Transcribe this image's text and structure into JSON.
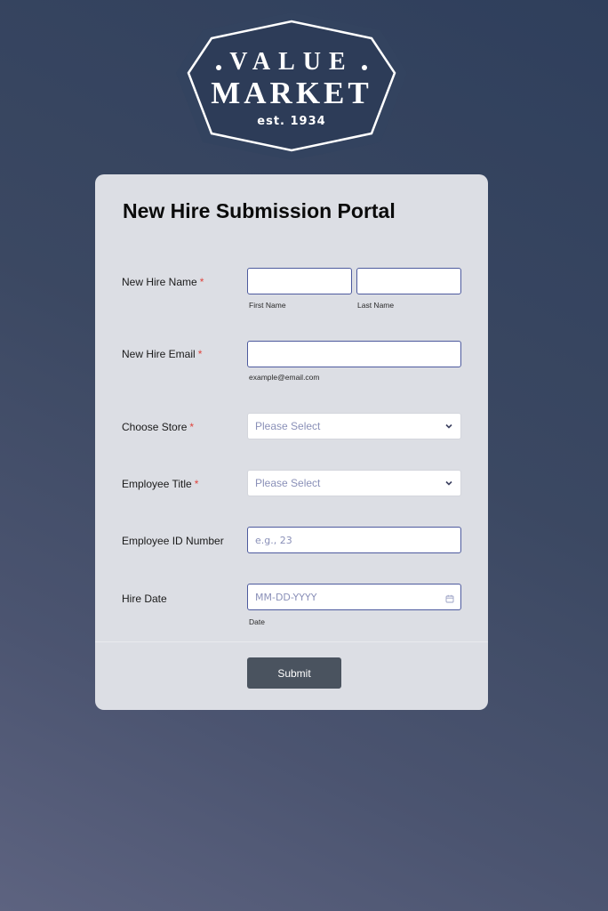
{
  "logo": {
    "line1": "VALUE",
    "line2": "MARKET",
    "line3": "est. 1934"
  },
  "form": {
    "title": "New Hire Submission Portal",
    "required_mark": "*",
    "name": {
      "label": "New Hire Name",
      "first_sub": "First Name",
      "last_sub": "Last Name",
      "first_value": "",
      "last_value": ""
    },
    "email": {
      "label": "New Hire Email",
      "sub": "example@email.com",
      "value": ""
    },
    "store": {
      "label": "Choose Store",
      "selected": "Please Select"
    },
    "title_field": {
      "label": "Employee Title",
      "selected": "Please Select"
    },
    "employee_id": {
      "label": "Employee ID Number",
      "placeholder": "e.g., 23"
    },
    "hire_date": {
      "label": "Hire Date",
      "placeholder": "MM-DD-YYYY",
      "sub": "Date"
    },
    "submit_label": "Submit"
  },
  "icons": {
    "select": "chevron-down-icon",
    "date": "calendar-icon"
  },
  "colors": {
    "background": "#3b4862",
    "card": "#dcdee4",
    "input_border": "#4d5a9e",
    "submit": "#4a535f",
    "required": "#e0433c"
  }
}
